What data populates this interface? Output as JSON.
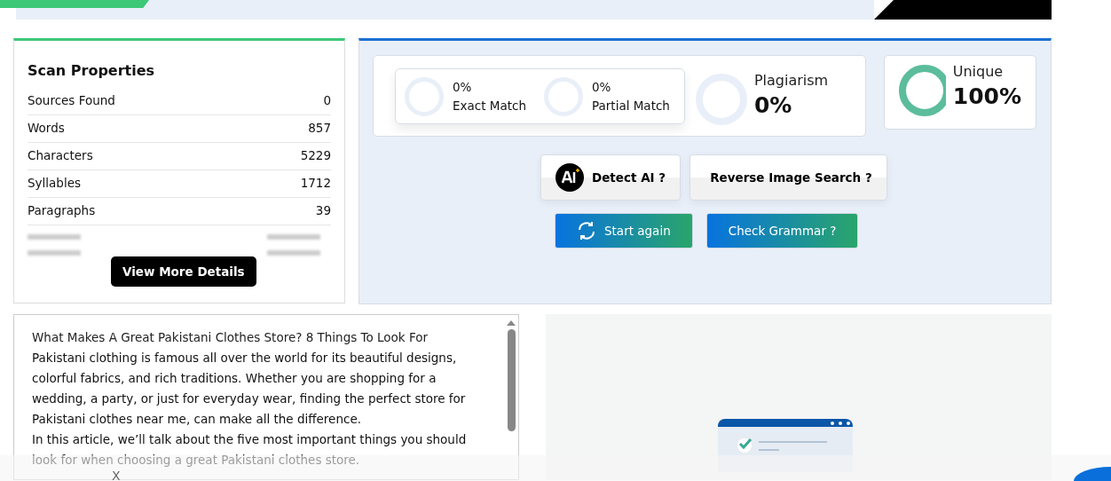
{
  "scan_properties": {
    "title": "Scan Properties",
    "rows": [
      {
        "label": "Sources Found",
        "value": "0"
      },
      {
        "label": "Words",
        "value": "857"
      },
      {
        "label": "Characters",
        "value": "5229"
      },
      {
        "label": "Syllables",
        "value": "1712"
      },
      {
        "label": "Paragraphs",
        "value": "39"
      }
    ],
    "button": "View More Details"
  },
  "results": {
    "matches": [
      {
        "value": "0%",
        "label": "Exact Match",
        "level": 0
      },
      {
        "value": "0%",
        "label": "Partial Match",
        "level": 0
      }
    ],
    "plagiarism": {
      "label": "Plagiarism",
      "value": "0%",
      "level": 0
    },
    "unique": {
      "label": "Unique",
      "value": "100%",
      "level": 1
    },
    "tools": [
      {
        "label": "Detect AI ?",
        "kind": "ai"
      },
      {
        "label": "Reverse Image Search ?",
        "kind": "plain"
      }
    ],
    "actions": [
      {
        "label": "Start again",
        "kind": "refresh"
      },
      {
        "label": "Check Grammar ?",
        "kind": "plain"
      }
    ]
  },
  "article": {
    "lines": [
      "What Makes A Great Pakistani Clothes Store? 8 Things To Look For",
      "Pakistani clothing is famous all over the world for its beautiful designs,",
      "colorful fabrics, and rich traditions. Whether you are shopping for a",
      "wedding, a party, or just for everyday wear, finding the perfect store for",
      "Pakistani clothes near me, can make all the difference.",
      "In this article, we’ll talk about the five most important things you should",
      "look for when choosing a great Pakistani clothes store."
    ]
  },
  "overlay": {
    "close": "X"
  }
}
